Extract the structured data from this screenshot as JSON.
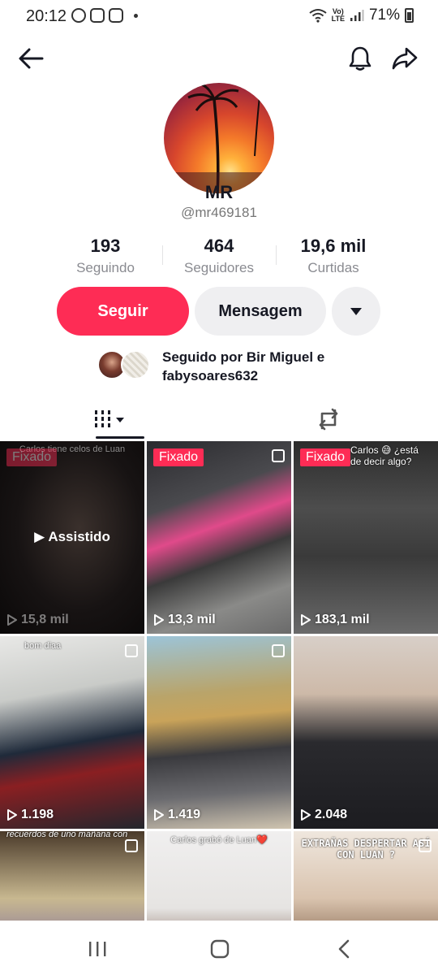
{
  "status": {
    "time": "20:12",
    "lte_top": "Vo)",
    "lte_bottom": "LTE",
    "battery": "71%"
  },
  "profile": {
    "name": "MR",
    "username": "@mr469181"
  },
  "stats": [
    {
      "value": "193",
      "label": "Seguindo"
    },
    {
      "value": "464",
      "label": "Seguidores"
    },
    {
      "value": "19,6 mil",
      "label": "Curtidas"
    }
  ],
  "actions": {
    "follow_label": "Seguir",
    "message_label": "Mensagem"
  },
  "followed_by": {
    "text": "Seguido por Bir Miguel e fabysoares632"
  },
  "videos": [
    {
      "pinned": "Fixado",
      "caption": "Carlos tiene celos de Luan",
      "views": "15,8 mil",
      "watched": "Assistido"
    },
    {
      "pinned": "Fixado",
      "caption": "",
      "views": "13,3 mil"
    },
    {
      "pinned": "Fixado",
      "caption": "Carlos 😅 ¿está de decir algo?",
      "views": "183,1 mil"
    },
    {
      "pinned": "",
      "caption": "bom diaa",
      "views": "1.198"
    },
    {
      "pinned": "",
      "caption": "",
      "views": "1.419"
    },
    {
      "pinned": "",
      "caption": "",
      "views": "2.048"
    },
    {
      "pinned": "",
      "caption": "recuerdos de uno mañana con",
      "views": ""
    },
    {
      "pinned": "",
      "caption": "Carlos grabó de Luan❤️",
      "views": ""
    },
    {
      "pinned": "",
      "caption": "EXTRAÑAS DESPERTAR ASÍ CON LUAN ?",
      "views": ""
    }
  ],
  "colors": {
    "accent": "#fe2c55",
    "button_gray": "#efeff1",
    "text_primary": "#161823",
    "text_secondary": "#8a8b91"
  },
  "icons": [
    "back-arrow-icon",
    "bell-icon",
    "share-icon",
    "chevron-down-icon",
    "grid-icon",
    "repost-icon",
    "play-icon",
    "multi-photo-icon",
    "recents-icon",
    "home-icon",
    "back-icon"
  ]
}
